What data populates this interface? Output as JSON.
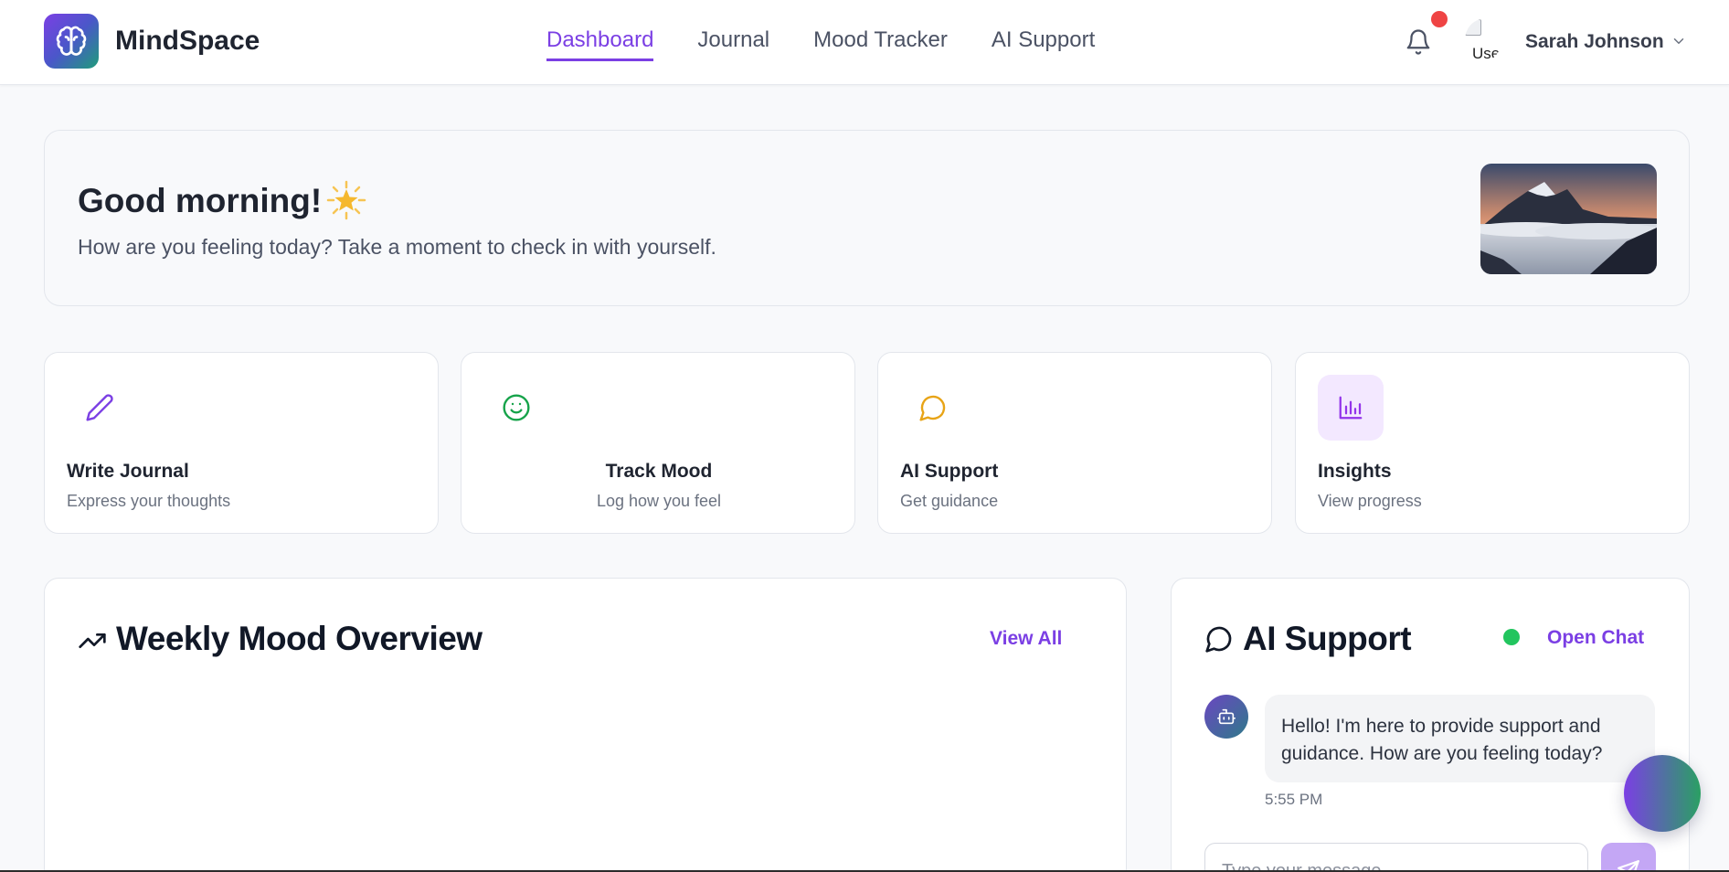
{
  "app": {
    "name": "MindSpace"
  },
  "nav": {
    "items": [
      {
        "label": "Dashboard",
        "active": true
      },
      {
        "label": "Journal",
        "active": false
      },
      {
        "label": "Mood Tracker",
        "active": false
      },
      {
        "label": "AI Support",
        "active": false
      }
    ]
  },
  "user": {
    "name": "Sarah Johnson",
    "avatar_alt": "Use",
    "has_notification": true
  },
  "welcome": {
    "greeting": "Good morning!",
    "subtitle": "How are you feeling today? Take a moment to check in with yourself."
  },
  "quick_actions": [
    {
      "title": "Write Journal",
      "subtitle": "Express your thoughts",
      "icon": "pencil-icon",
      "color": "#7b3fe4"
    },
    {
      "title": "Track Mood",
      "subtitle": "Log how you feel",
      "icon": "smile-icon",
      "color": "#16a34a"
    },
    {
      "title": "AI Support",
      "subtitle": "Get guidance",
      "icon": "chat-bubble-icon",
      "color": "#e8a417"
    },
    {
      "title": "Insights",
      "subtitle": "View progress",
      "icon": "bar-chart-icon",
      "color": "#9333ea"
    }
  ],
  "mood_overview": {
    "title": "Weekly Mood Overview",
    "view_all_label": "View All"
  },
  "ai_support": {
    "title": "AI Support",
    "open_chat_label": "Open Chat",
    "status": "online",
    "message": "Hello! I'm here to provide support and guidance. How are you feeling today?",
    "message_time": "5:55 PM",
    "input_placeholder": "Type your message..."
  },
  "colors": {
    "accent": "#7b3fe4",
    "online": "#22c55e",
    "notification": "#ef4444"
  }
}
